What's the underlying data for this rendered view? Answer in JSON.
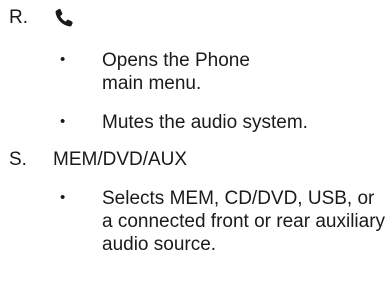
{
  "items": [
    {
      "letter": "R.",
      "heading": "",
      "heading_icon": "phone-icon",
      "bullets": [
        {
          "marker": "•",
          "text": "Opens the Phone main menu."
        },
        {
          "marker": "•",
          "text": "Mutes the audio system."
        }
      ]
    },
    {
      "letter": "S.",
      "heading": "MEM/DVD/AUX",
      "bullets": [
        {
          "marker": "•",
          "text": "Selects MEM, CD/DVD, USB, or a connected front or rear auxiliary audio source."
        }
      ]
    }
  ]
}
